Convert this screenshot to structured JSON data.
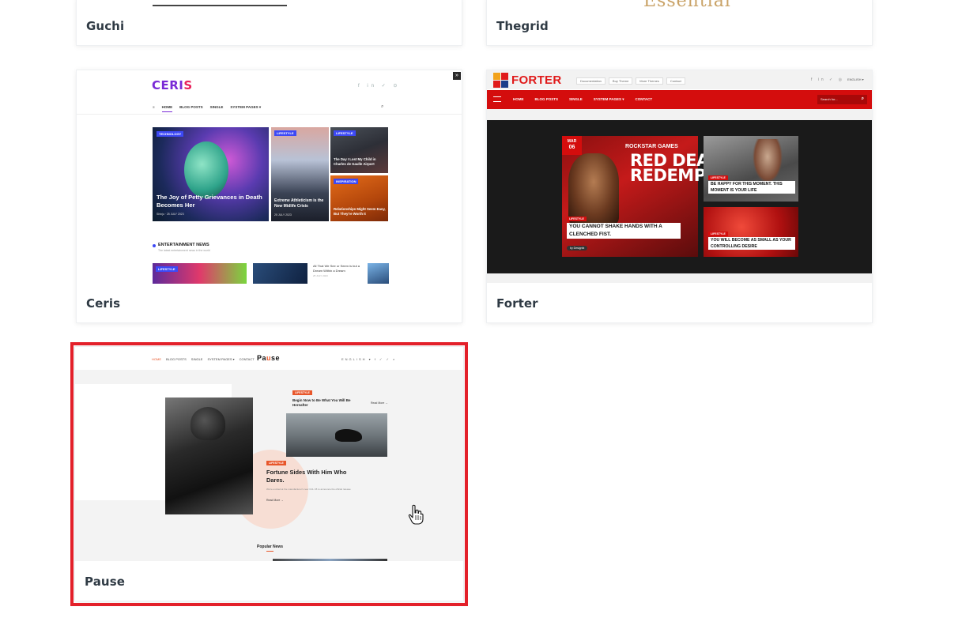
{
  "cards": {
    "guchi": {
      "caption": "Guchi"
    },
    "thegrid": {
      "caption": "Thegrid",
      "preview_word": "Essential"
    },
    "ceris": {
      "caption": "Ceris",
      "logo_main": "CERI",
      "logo_accent": "S",
      "social": "f in ✓ ⊙",
      "expand": "»",
      "nav": [
        "HOME",
        "BLOG POSTS",
        "SINGLE",
        "SYSTEM PAGES ▾"
      ],
      "search": "⌕",
      "featured": {
        "tag": "TECHNOLOGY",
        "title": "The Joy of Petty Grievances in Death Becomes Her",
        "meta": "Shinju · 25 JULY 2023"
      },
      "mid": {
        "tag": "LIFESTYLE",
        "title": "Extreme Athleticism is the New Midlife Crisis",
        "meta": "25 JULY 2023"
      },
      "top_right": {
        "tag": "LIFESTYLE",
        "title": "The Day I Lost My Child in Charles de Gaulle Airport"
      },
      "bottom_right": {
        "tag": "INSPIRATION",
        "title": "Relationships Might Seem Easy, But They're Worth It"
      },
      "section_title": "ENTERTAINMENT NEWS",
      "section_sub": "The latest entertainment news in the world",
      "row_tag": "LIFESTYLE",
      "row_text": "All That We See or Seem is but a Dream Within a Dream",
      "row_meta": "25 JULY 2023"
    },
    "forter": {
      "caption": "Forter",
      "logo": "FORTER",
      "links": [
        "Documentation",
        "Buy Theme",
        "More Themes",
        "Contact"
      ],
      "social": "f in ✓ ◎",
      "language": "ENGLISH ▾",
      "nav": [
        "HOME",
        "BLOG POSTS",
        "SINGLE",
        "SYSTEM PAGES ▾",
        "CONTACT"
      ],
      "search_placeholder": "Search for...",
      "date_month": "MAR",
      "date_day": "06",
      "main_overlay_small": "ROCKSTAR GAMES",
      "main_overlay_big": "RED DEAD REDEMPTION",
      "main_tag": "LIFESTYLE",
      "main_title": "YOU CANNOT SHAKE HANDS WITH A CLENCHED FIST.",
      "author": "by Designfx",
      "tr_tag": "LIFESTYLE",
      "tr_title": "BE HAPPY FOR THIS MOMENT. THIS MOMENT IS YOUR LIFE",
      "br_tag": "LIFESTYLE",
      "br_title": "YOU WILL BECOME AS SMALL AS YOUR CONTROLLING DESIRE"
    },
    "pause": {
      "caption": "Pause",
      "nav": [
        "HOME",
        "BLOG POSTS",
        "SINGLE",
        "SYSTEM PAGES ▾",
        "CONTACT"
      ],
      "logo_a": "Pa",
      "logo_accent": "u",
      "logo_b": "se",
      "right": "ENGLISH ▾  f ✓ ✓ ⌕",
      "tag1": "LIFESTYLE",
      "title1": "Begin Now to Be What You Will Be Hereafter",
      "readmore": "Read More →",
      "tag2": "LIFESTYLE",
      "title2": "Fortune Sides With Him Who Dares.",
      "desc": "We're excited at the manufacturer's new 3.0L V8 to announce the official release",
      "popular": "Popular News"
    }
  },
  "selection": {
    "selected_card": "Pause",
    "color": "#e3202a"
  },
  "colors": {
    "ceris_accent": "#7a2bd6",
    "forter_red": "#d40d0d",
    "pause_accent": "#e8562a"
  }
}
